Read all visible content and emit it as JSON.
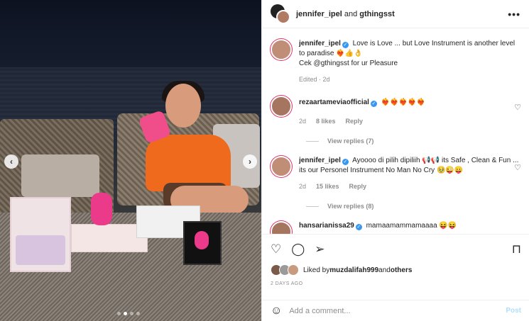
{
  "header": {
    "user1": "jennifer_ipel",
    "joiner": " and ",
    "user2": "gthingsst",
    "more": "•••"
  },
  "caption": {
    "username": "jennifer_ipel",
    "text_line1": " Love is Love ... but Love Instrument is another level to paradise ❤️‍🔥👍👌",
    "text_line2": "Cek @gthingsst for ur Pleasure",
    "meta": "Edited · 2d"
  },
  "comments": [
    {
      "username": "rezaartameviaofficial",
      "text": " ❤️‍🔥❤️‍🔥❤️‍🔥❤️‍🔥❤️‍🔥",
      "time": "2d",
      "likes": "8 likes",
      "reply": "Reply",
      "view_replies": "View replies (7)"
    },
    {
      "username": "jennifer_ipel",
      "text": " Ayoooo di pilih dipiliih 📢📢 its Safe , Clean & Fun ... its our Personel Instrument No Man No Cry 🥹😜😛",
      "time": "2d",
      "likes": "15 likes",
      "reply": "Reply",
      "view_replies": "View replies (8)"
    },
    {
      "username": "hansarianissa29",
      "text": " mamaamammamaaaa 😝😝"
    }
  ],
  "actions": {
    "liked_by_prefix": "Liked by ",
    "liked_by_user": "muzdalifah999",
    "liked_by_and": " and ",
    "liked_by_others": "others",
    "date": "2 DAYS AGO"
  },
  "add_comment": {
    "placeholder": "Add a comment...",
    "post": "Post"
  },
  "media": {
    "slides": 4,
    "active_slide": 1
  }
}
